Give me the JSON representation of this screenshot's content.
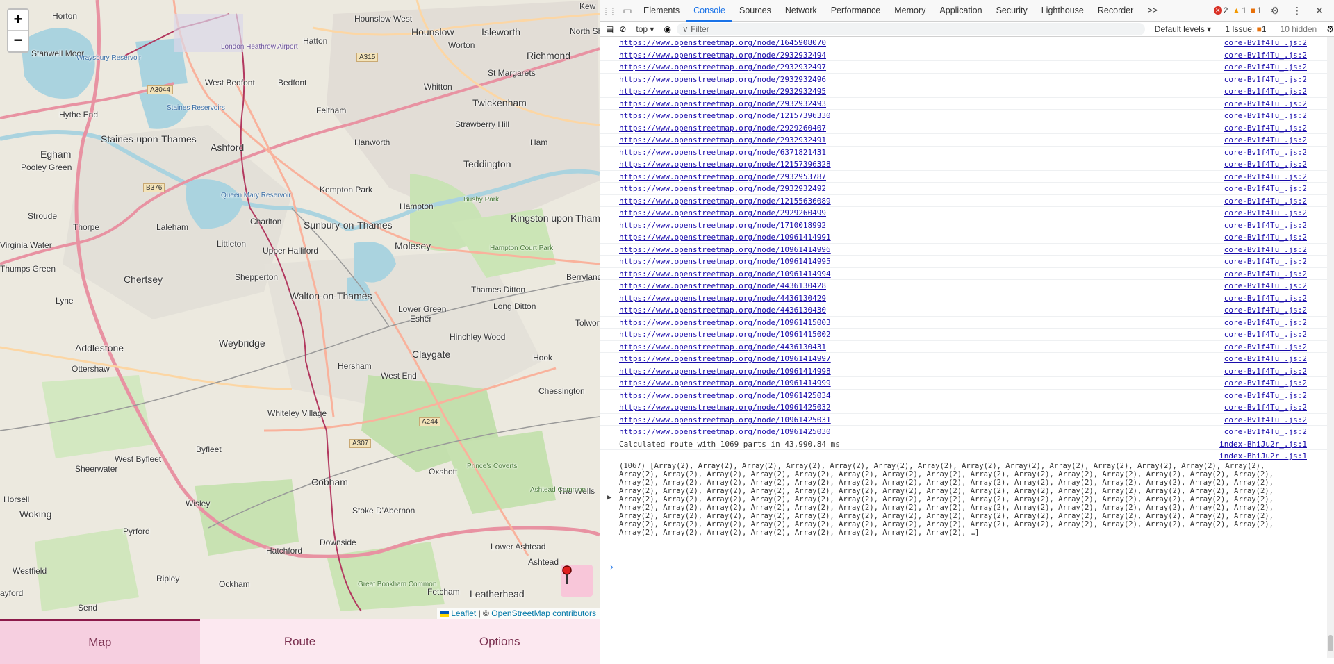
{
  "map": {
    "zoom_in": "+",
    "zoom_out": "−",
    "attribution_leaflet": "Leaflet",
    "attribution_sep": "| ©",
    "attribution_osm": "OpenStreetMap contributors",
    "places": [
      {
        "name": "Horton"
      },
      {
        "name": "Hounslow West"
      },
      {
        "name": "Hounslow"
      },
      {
        "name": "Isleworth"
      },
      {
        "name": "Kew"
      },
      {
        "name": "Stanwell Moor"
      },
      {
        "name": "Hatton"
      },
      {
        "name": "Worton"
      },
      {
        "name": "North Sh"
      },
      {
        "name": "Wraysbury Reservoir"
      },
      {
        "name": "London Heathrow Airport"
      },
      {
        "name": "St Margarets"
      },
      {
        "name": "Richmond"
      },
      {
        "name": "West Bedfont"
      },
      {
        "name": "Bedfont"
      },
      {
        "name": "Whitton"
      },
      {
        "name": "Hythe End"
      },
      {
        "name": "Staines Reservoirs"
      },
      {
        "name": "Feltham"
      },
      {
        "name": "Twickenham"
      },
      {
        "name": "Staines-upon-Thames"
      },
      {
        "name": "Strawberry Hill"
      },
      {
        "name": "Hanworth"
      },
      {
        "name": "Ham"
      },
      {
        "name": "Egham"
      },
      {
        "name": "Ashford"
      },
      {
        "name": "Teddington"
      },
      {
        "name": "Pooley Green"
      },
      {
        "name": "Kempton Park"
      },
      {
        "name": "Queen Mary Reservoir"
      },
      {
        "name": "Bushy Park"
      },
      {
        "name": "Hampton"
      },
      {
        "name": "Stroude"
      },
      {
        "name": "Charlton"
      },
      {
        "name": "Kingston upon Thames"
      },
      {
        "name": "Thorpe"
      },
      {
        "name": "Laleham"
      },
      {
        "name": "Sunbury-on-Thames"
      },
      {
        "name": "Molesey"
      },
      {
        "name": "Virginia Water"
      },
      {
        "name": "Littleton"
      },
      {
        "name": "Upper Halliford"
      },
      {
        "name": "Hampton Court Park"
      },
      {
        "name": "Thumps Green"
      },
      {
        "name": "Shepperton"
      },
      {
        "name": "Berrylands"
      },
      {
        "name": "Chertsey"
      },
      {
        "name": "Thames Ditton"
      },
      {
        "name": "Walton-on-Thames"
      },
      {
        "name": "Long Ditton"
      },
      {
        "name": "Lyne"
      },
      {
        "name": "Lower Green"
      },
      {
        "name": "Esher"
      },
      {
        "name": "Tolworth"
      },
      {
        "name": "Addlestone"
      },
      {
        "name": "Weybridge"
      },
      {
        "name": "Hinchley Wood"
      },
      {
        "name": "Ottershaw"
      },
      {
        "name": "Hersham"
      },
      {
        "name": "Hook"
      },
      {
        "name": "West End"
      },
      {
        "name": "Claygate"
      },
      {
        "name": "Chessington"
      },
      {
        "name": "Whiteley Village"
      },
      {
        "name": "Byfleet"
      },
      {
        "name": "West Byfleet"
      },
      {
        "name": "Sheerwater"
      },
      {
        "name": "Oxshott"
      },
      {
        "name": "Prince's Coverts"
      },
      {
        "name": "Cobham"
      },
      {
        "name": "The Wells"
      },
      {
        "name": "Ashtead Common"
      },
      {
        "name": "Horsell"
      },
      {
        "name": "Wisley"
      },
      {
        "name": "Woking"
      },
      {
        "name": "Pyrford"
      },
      {
        "name": "Stoke D'Abernon"
      },
      {
        "name": "Downside"
      },
      {
        "name": "Lower Ashtead"
      },
      {
        "name": "Hatchford"
      },
      {
        "name": "Westfield"
      },
      {
        "name": "Ashtead"
      },
      {
        "name": "Ripley"
      },
      {
        "name": "Ockham"
      },
      {
        "name": "Great Bookham Common"
      },
      {
        "name": "Leatherhead"
      },
      {
        "name": "Fetcham"
      },
      {
        "name": "Send"
      },
      {
        "name": "ayford"
      }
    ],
    "roads": [
      "A315",
      "A3044",
      "B376",
      "A244",
      "A307"
    ],
    "pin_icon": "map-pin-icon"
  },
  "tabs": [
    {
      "label": "Map",
      "active": true
    },
    {
      "label": "Route",
      "active": false
    },
    {
      "label": "Options",
      "active": false
    }
  ],
  "devtools": {
    "tabs": [
      "Elements",
      "Console",
      "Sources",
      "Network",
      "Performance",
      "Memory",
      "Application",
      "Security",
      "Lighthouse",
      "Recorder"
    ],
    "active_tab": "Console",
    "more": ">>",
    "errors": "2",
    "warnings": "1",
    "issues_count": "1",
    "context": "top",
    "filter_placeholder": "Filter",
    "levels": "Default levels",
    "issues_label": "1 Issue:",
    "issues_badge": "1",
    "hidden": "10 hidden",
    "log_rows": [
      {
        "url": "https://www.openstreetmap.org/node/1645908070",
        "src": "core-Bv1f4Tu_.js:2"
      },
      {
        "url": "https://www.openstreetmap.org/node/2932932494",
        "src": "core-Bv1f4Tu_.js:2"
      },
      {
        "url": "https://www.openstreetmap.org/node/2932932497",
        "src": "core-Bv1f4Tu_.js:2"
      },
      {
        "url": "https://www.openstreetmap.org/node/2932932496",
        "src": "core-Bv1f4Tu_.js:2"
      },
      {
        "url": "https://www.openstreetmap.org/node/2932932495",
        "src": "core-Bv1f4Tu_.js:2"
      },
      {
        "url": "https://www.openstreetmap.org/node/2932932493",
        "src": "core-Bv1f4Tu_.js:2"
      },
      {
        "url": "https://www.openstreetmap.org/node/12157396330",
        "src": "core-Bv1f4Tu_.js:2"
      },
      {
        "url": "https://www.openstreetmap.org/node/2929260407",
        "src": "core-Bv1f4Tu_.js:2"
      },
      {
        "url": "https://www.openstreetmap.org/node/2932932491",
        "src": "core-Bv1f4Tu_.js:2"
      },
      {
        "url": "https://www.openstreetmap.org/node/6371821431",
        "src": "core-Bv1f4Tu_.js:2"
      },
      {
        "url": "https://www.openstreetmap.org/node/12157396328",
        "src": "core-Bv1f4Tu_.js:2"
      },
      {
        "url": "https://www.openstreetmap.org/node/2932953787",
        "src": "core-Bv1f4Tu_.js:2"
      },
      {
        "url": "https://www.openstreetmap.org/node/2932932492",
        "src": "core-Bv1f4Tu_.js:2"
      },
      {
        "url": "https://www.openstreetmap.org/node/12155636089",
        "src": "core-Bv1f4Tu_.js:2"
      },
      {
        "url": "https://www.openstreetmap.org/node/2929260499",
        "src": "core-Bv1f4Tu_.js:2"
      },
      {
        "url": "https://www.openstreetmap.org/node/1710018992",
        "src": "core-Bv1f4Tu_.js:2"
      },
      {
        "url": "https://www.openstreetmap.org/node/10961414991",
        "src": "core-Bv1f4Tu_.js:2"
      },
      {
        "url": "https://www.openstreetmap.org/node/10961414996",
        "src": "core-Bv1f4Tu_.js:2"
      },
      {
        "url": "https://www.openstreetmap.org/node/10961414995",
        "src": "core-Bv1f4Tu_.js:2"
      },
      {
        "url": "https://www.openstreetmap.org/node/10961414994",
        "src": "core-Bv1f4Tu_.js:2"
      },
      {
        "url": "https://www.openstreetmap.org/node/4436130428",
        "src": "core-Bv1f4Tu_.js:2"
      },
      {
        "url": "https://www.openstreetmap.org/node/4436130429",
        "src": "core-Bv1f4Tu_.js:2"
      },
      {
        "url": "https://www.openstreetmap.org/node/4436130430",
        "src": "core-Bv1f4Tu_.js:2"
      },
      {
        "url": "https://www.openstreetmap.org/node/10961415003",
        "src": "core-Bv1f4Tu_.js:2"
      },
      {
        "url": "https://www.openstreetmap.org/node/10961415002",
        "src": "core-Bv1f4Tu_.js:2"
      },
      {
        "url": "https://www.openstreetmap.org/node/4436130431",
        "src": "core-Bv1f4Tu_.js:2"
      },
      {
        "url": "https://www.openstreetmap.org/node/10961414997",
        "src": "core-Bv1f4Tu_.js:2"
      },
      {
        "url": "https://www.openstreetmap.org/node/10961414998",
        "src": "core-Bv1f4Tu_.js:2"
      },
      {
        "url": "https://www.openstreetmap.org/node/10961414999",
        "src": "core-Bv1f4Tu_.js:2"
      },
      {
        "url": "https://www.openstreetmap.org/node/10961425034",
        "src": "core-Bv1f4Tu_.js:2"
      },
      {
        "url": "https://www.openstreetmap.org/node/10961425032",
        "src": "core-Bv1f4Tu_.js:2"
      },
      {
        "url": "https://www.openstreetmap.org/node/10961425031",
        "src": "core-Bv1f4Tu_.js:2"
      },
      {
        "url": "https://www.openstreetmap.org/node/10961425030",
        "src": "core-Bv1f4Tu_.js:2"
      }
    ],
    "route_msg": "Calculated route with 1069 parts in 43,990.84 ms",
    "route_src": "index-BhiJu2r_.js:1",
    "array_src": "index-BhiJu2r_.js:1",
    "array_text": "(1067) [Array(2), Array(2), Array(2), Array(2), Array(2), Array(2), Array(2), Array(2), Array(2), Array(2), Array(2), Array(2), Array(2), Array(2), Array(2), Array(2), Array(2), Array(2), Array(2), Array(2), Array(2), Array(2), Array(2), Array(2), Array(2), Array(2), Array(2), Array(2), Array(2), Array(2), Array(2), Array(2), Array(2), Array(2), Array(2), Array(2), Array(2), Array(2), Array(2), Array(2), Array(2), Array(2), Array(2), Array(2), Array(2), Array(2), Array(2), Array(2), Array(2), Array(2), Array(2), Array(2), Array(2), Array(2), Array(2), Array(2), Array(2), Array(2), Array(2), Array(2), Array(2), Array(2), Array(2), Array(2), Array(2), Array(2), Array(2), Array(2), Array(2), Array(2), Array(2), Array(2), Array(2), Array(2), Array(2), Array(2), Array(2), Array(2), Array(2), Array(2), Array(2), Array(2), Array(2), Array(2), Array(2), Array(2), Array(2), Array(2), Array(2), Array(2), Array(2), Array(2), Array(2), Array(2), Array(2), Array(2), Array(2), Array(2), Array(2), Array(2), Array(2), Array(2), Array(2), Array(2), Array(2), Array(2), Array(2), Array(2), Array(2), Array(2), Array(2), Array(2), Array(2), Array(2), Array(2), Array(2), Array(2), Array(2), Array(2), Array(2), Array(2), Array(2), Array(2), Array(2), Array(2), Array(2), Array(2), …]",
    "prompt": "›"
  }
}
